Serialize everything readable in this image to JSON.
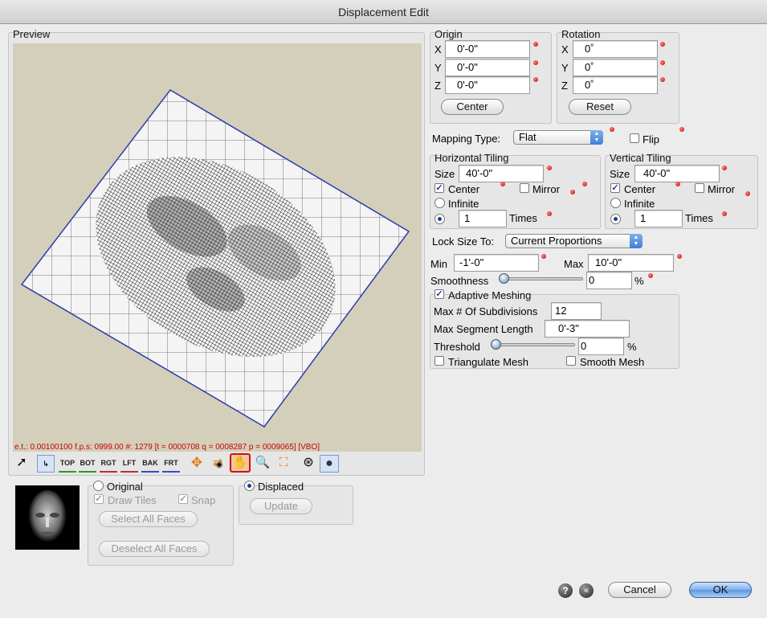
{
  "window": {
    "title": "Displacement Edit"
  },
  "preview": {
    "title": "Preview",
    "status": "e.t.: 0.00100100   f.p.s: 0999.00   #: 1279   [t = 0000708 q = 0008287 p = 0009065] [VBO]",
    "toolbar": [
      "TOP",
      "BOT",
      "RGT",
      "LFT",
      "BAK",
      "FRT"
    ]
  },
  "origin": {
    "title": "Origin",
    "x_label": "X",
    "y_label": "Y",
    "z_label": "Z",
    "x": "0'-0\"",
    "y": "0'-0\"",
    "z": "0'-0\"",
    "button": "Center"
  },
  "rotation": {
    "title": "Rotation",
    "x_label": "X",
    "y_label": "Y",
    "z_label": "Z",
    "x": "0˚",
    "y": "0˚",
    "z": "0˚",
    "button": "Reset"
  },
  "mapping": {
    "label": "Mapping Type:",
    "value": "Flat",
    "flip_label": "Flip"
  },
  "htiling": {
    "title": "Horizontal Tiling",
    "size_label": "Size",
    "size": "40'-0\"",
    "center_label": "Center",
    "mirror_label": "Mirror",
    "infinite_label": "Infinite",
    "times_value": "1",
    "times_label": "Times"
  },
  "vtiling": {
    "title": "Vertical Tiling",
    "size_label": "Size",
    "size": "40'-0\"",
    "center_label": "Center",
    "mirror_label": "Mirror",
    "infinite_label": "Infinite",
    "times_value": "1",
    "times_label": "Times"
  },
  "lock": {
    "label": "Lock Size To:",
    "value": "Current Proportions"
  },
  "range": {
    "min_label": "Min",
    "min": "-1'-0\"",
    "max_label": "Max",
    "max": "10'-0\""
  },
  "smoothness": {
    "label": "Smoothness",
    "value": "0",
    "unit": "%"
  },
  "meshing": {
    "title": "Adaptive Meshing",
    "subdiv_label": "Max # Of Subdivisions",
    "subdiv": "12",
    "seg_label": "Max Segment Length",
    "seg": "0'-3\"",
    "threshold_label": "Threshold",
    "threshold": "0",
    "unit": "%",
    "tri_label": "Triangulate Mesh",
    "smooth_label": "Smooth Mesh"
  },
  "original": {
    "title": "Original",
    "draw_tiles": "Draw Tiles",
    "snap": "Snap",
    "select_all": "Select All Faces",
    "deselect_all": "Deselect All Faces"
  },
  "displaced": {
    "title": "Displaced",
    "update": "Update"
  },
  "footer": {
    "cancel": "Cancel",
    "ok": "OK"
  },
  "colors": {
    "accent": "#3f7fd6",
    "required_dot": "#c00000",
    "status_text": "#cc0000",
    "preview_bg": "#d3cfbb"
  },
  "icons": [
    "arrow-pointer-icon",
    "axis-icon",
    "pan-icon",
    "orbit-icon",
    "eye-icon",
    "hand-icon",
    "zoom-icon",
    "fit-icon",
    "wireframe-sphere-icon",
    "shaded-sphere-icon",
    "help-icon",
    "back-icon"
  ]
}
